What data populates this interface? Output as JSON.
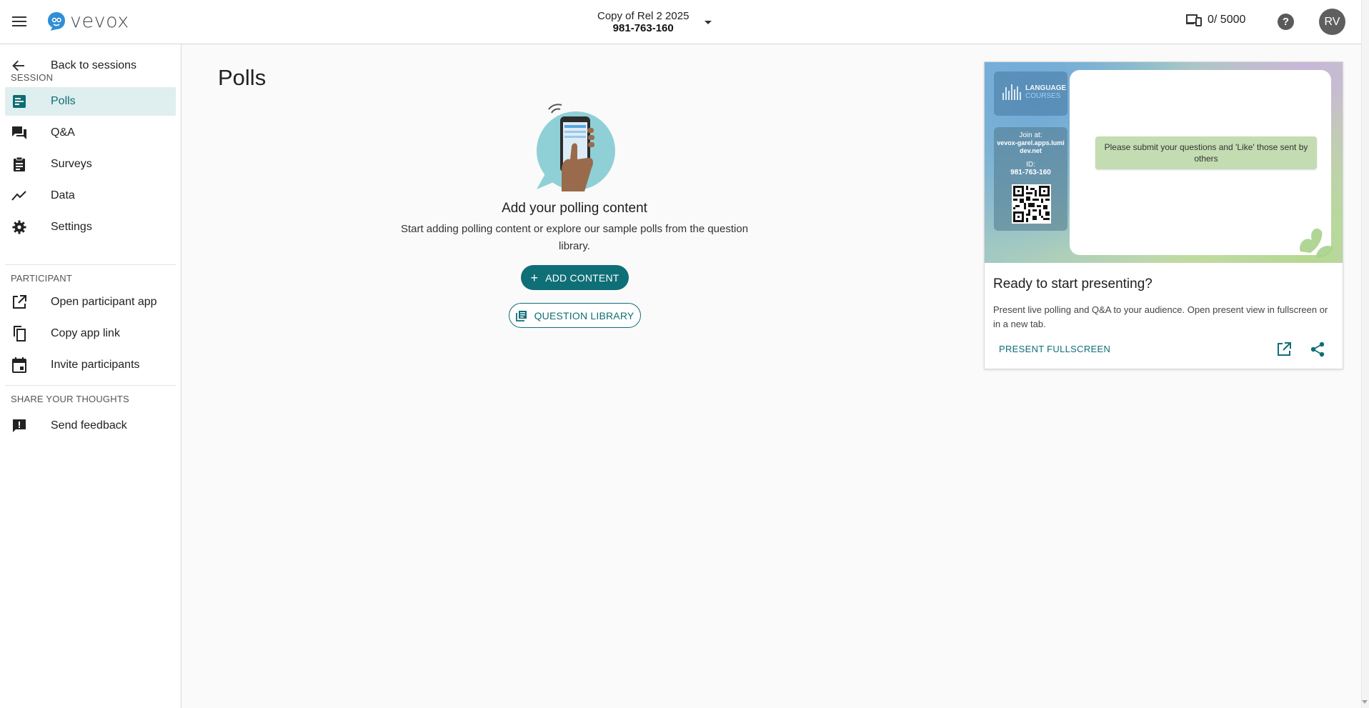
{
  "header": {
    "logo_text": "vevox",
    "session_name": "Copy of Rel 2 2025",
    "session_id": "981-763-160",
    "participants": "0/ 5000",
    "help_label": "?",
    "avatar_initials": "RV"
  },
  "sidebar": {
    "back_label": "Back to sessions",
    "session_section": "SESSION",
    "session_items": [
      {
        "label": "Polls",
        "icon": "polls-icon",
        "active": true
      },
      {
        "label": "Q&A",
        "icon": "qa-icon"
      },
      {
        "label": "Surveys",
        "icon": "surveys-icon"
      },
      {
        "label": "Data",
        "icon": "data-icon"
      },
      {
        "label": "Settings",
        "icon": "gear-icon"
      }
    ],
    "participant_section": "PARTICIPANT",
    "participant_items": [
      {
        "label": "Open participant app",
        "icon": "open-external-icon"
      },
      {
        "label": "Copy app link",
        "icon": "copy-icon"
      },
      {
        "label": "Invite participants",
        "icon": "calendar-icon"
      }
    ],
    "feedback_section": "SHARE YOUR THOUGHTS",
    "feedback_items": [
      {
        "label": "Send feedback",
        "icon": "feedback-icon"
      }
    ]
  },
  "main": {
    "title": "Polls",
    "empty_title": "Add your polling content",
    "empty_description": "Start adding polling content or explore our sample polls from the question library.",
    "add_content_label": "ADD CONTENT",
    "add_content_icon": "+",
    "question_library_label": "QUESTION LIBRARY"
  },
  "present_card": {
    "preview_logo_line1": "LANGUAGE",
    "preview_logo_line2": "COURSES",
    "preview_join_label": "Join at:",
    "preview_url": "vevox-garel.apps.lumidev.net",
    "preview_id_label": "ID:",
    "preview_id": "981-763-160",
    "preview_message": "Please submit your questions and 'Like' those sent by others",
    "title": "Ready to start presenting?",
    "description": "Present live polling and Q&A to your audience. Open present view in fullscreen or in a new tab.",
    "present_fullscreen_label": "PRESENT FULLSCREEN"
  },
  "colors": {
    "accent": "#0f6f76",
    "active_bg": "#dfeeee",
    "logo_blue": "#2f8fd8"
  }
}
